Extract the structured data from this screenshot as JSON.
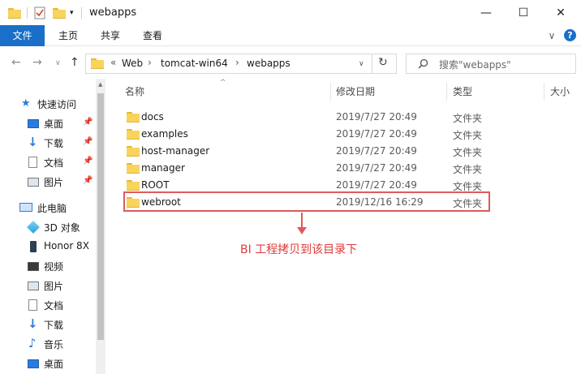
{
  "window": {
    "title": "webapps",
    "minimize_glyph": "—",
    "maximize_glyph": "☐",
    "close_glyph": "✕"
  },
  "ribbon": {
    "tabs": [
      "文件",
      "主页",
      "共享",
      "查看"
    ],
    "expand_glyph": "∨",
    "help_glyph": "?"
  },
  "nav": {
    "back": "←",
    "forward": "→",
    "recent": "∨",
    "up": "↑",
    "breadcrumb_prefix": "«",
    "breadcrumbs": [
      "Web",
      "tomcat-win64",
      "webapps"
    ],
    "dropdown": "∨",
    "refresh": "↻"
  },
  "search": {
    "placeholder": "搜索\"webapps\""
  },
  "sidebar": {
    "quick_access": "快速访问",
    "quick_items": [
      "桌面",
      "下载",
      "文档",
      "图片"
    ],
    "this_pc": "此电脑",
    "pc_items": [
      "3D 对象",
      "Honor 8X",
      "视频",
      "图片",
      "文档",
      "下载",
      "音乐",
      "桌面"
    ]
  },
  "columns": {
    "name": "名称",
    "date": "修改日期",
    "type": "类型",
    "size": "大小"
  },
  "files": [
    {
      "name": "docs",
      "date": "2019/7/27 20:49",
      "type": "文件夹"
    },
    {
      "name": "examples",
      "date": "2019/7/27 20:49",
      "type": "文件夹"
    },
    {
      "name": "host-manager",
      "date": "2019/7/27 20:49",
      "type": "文件夹"
    },
    {
      "name": "manager",
      "date": "2019/7/27 20:49",
      "type": "文件夹"
    },
    {
      "name": "ROOT",
      "date": "2019/7/27 20:49",
      "type": "文件夹"
    },
    {
      "name": "webroot",
      "date": "2019/12/16 16:29",
      "type": "文件夹"
    }
  ],
  "annotation": "BI 工程拷贝到该目录下",
  "colors": {
    "accent": "#1a6fc8",
    "highlight": "#e05a5a",
    "folder": "#f8d45c"
  }
}
